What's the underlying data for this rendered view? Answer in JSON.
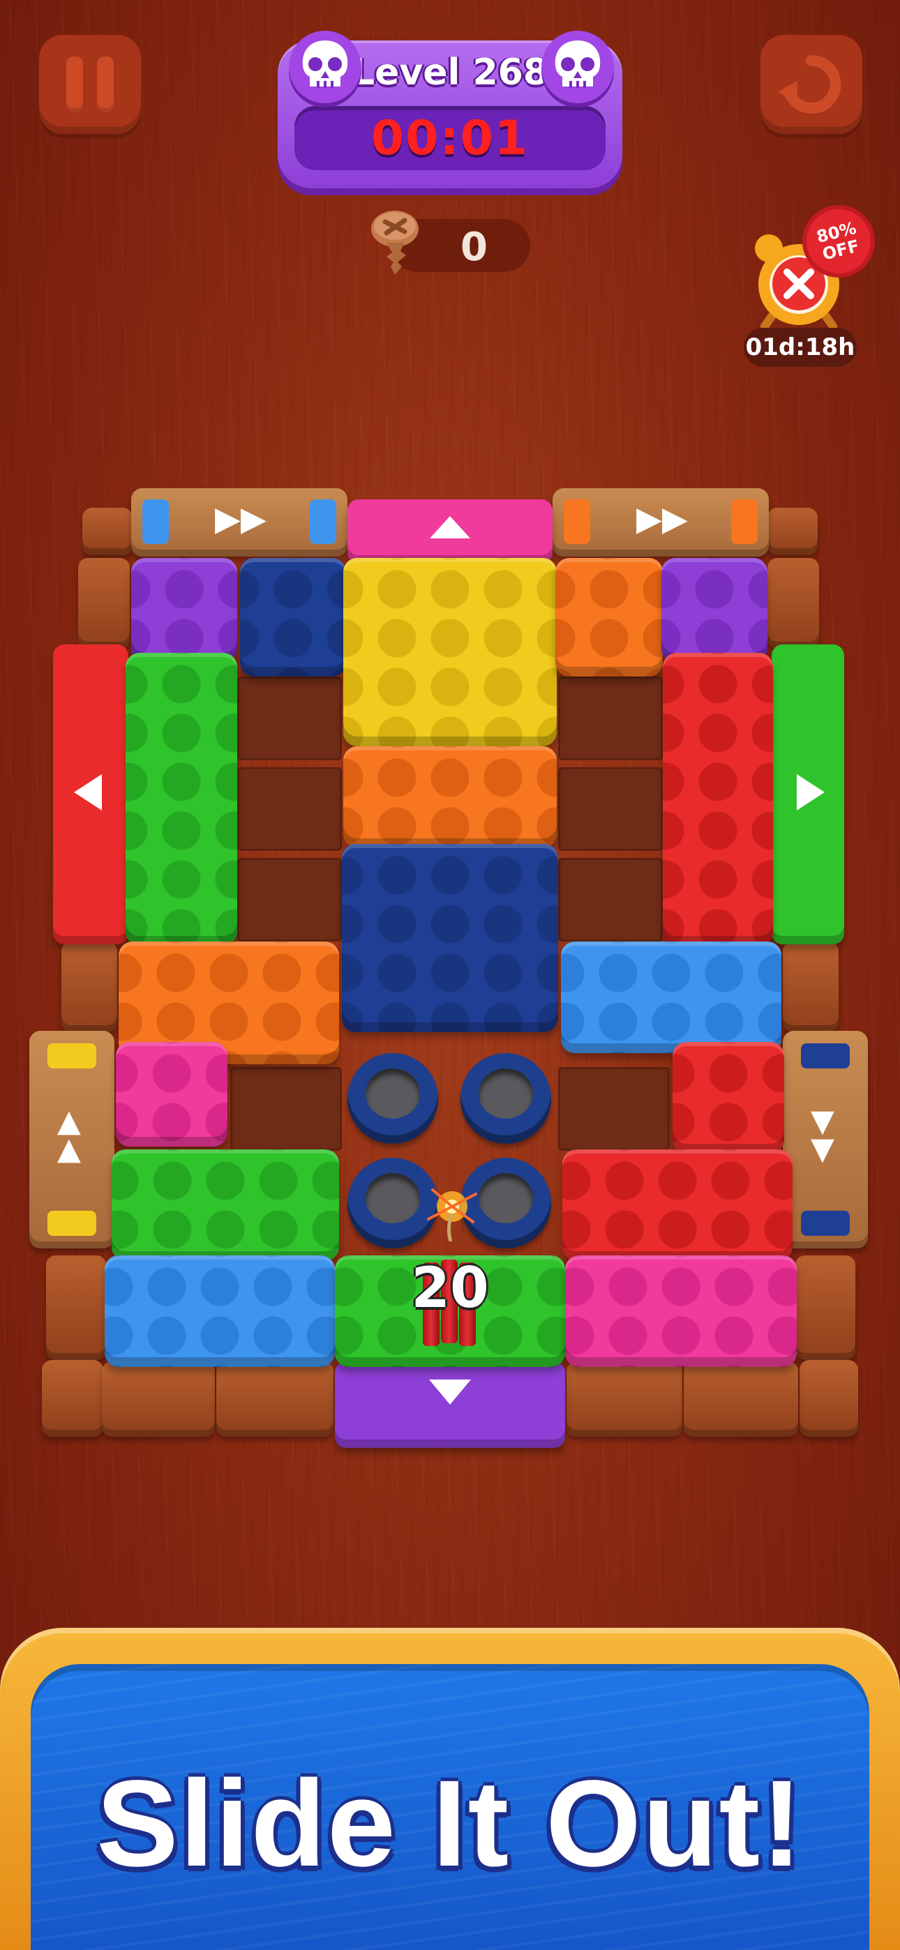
{
  "hud": {
    "level_label": "Level 268",
    "timer": "00:01",
    "screw_count": "0",
    "offer_discount": "80% OFF",
    "offer_timer": "01d:18h"
  },
  "board": {
    "bomb_counter": "20"
  },
  "banner": {
    "headline": "Slide It Out!"
  },
  "icons": [
    "pause-icon",
    "restart-icon",
    "skull-icon",
    "screw-icon",
    "alarm-clock-icon",
    "close-icon",
    "bomb-icon"
  ],
  "colors": {
    "purple": "#8d3fd6",
    "navy": "#1f3f95",
    "yellow": "#f1cc1e",
    "orange": "#f7761f",
    "green": "#2fc42b",
    "red": "#ea2b2b",
    "light_blue": "#3f95ee",
    "pink": "#f03a9c",
    "timer_red": "#ff2020"
  }
}
